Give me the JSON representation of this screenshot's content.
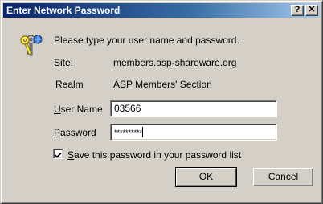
{
  "window": {
    "title": "Enter Network Password",
    "help_glyph": "?",
    "close_glyph": "✕"
  },
  "prompt": "Please type your user name and password.",
  "site": {
    "label": "Site:",
    "value": "members.asp-shareware.org"
  },
  "realm": {
    "label": "Realm",
    "value": "ASP Members' Section"
  },
  "username": {
    "label_underlined": "U",
    "label_rest": "ser Name",
    "value": "03566"
  },
  "password": {
    "label_underlined": "P",
    "label_rest": "assword",
    "masked_value": "**********"
  },
  "save_password": {
    "checked": true,
    "label_underlined": "S",
    "label_rest": "ave this password in your password list"
  },
  "buttons": {
    "ok": "OK",
    "cancel": "Cancel"
  },
  "icons": {
    "dialog_icon": "key-icon"
  }
}
